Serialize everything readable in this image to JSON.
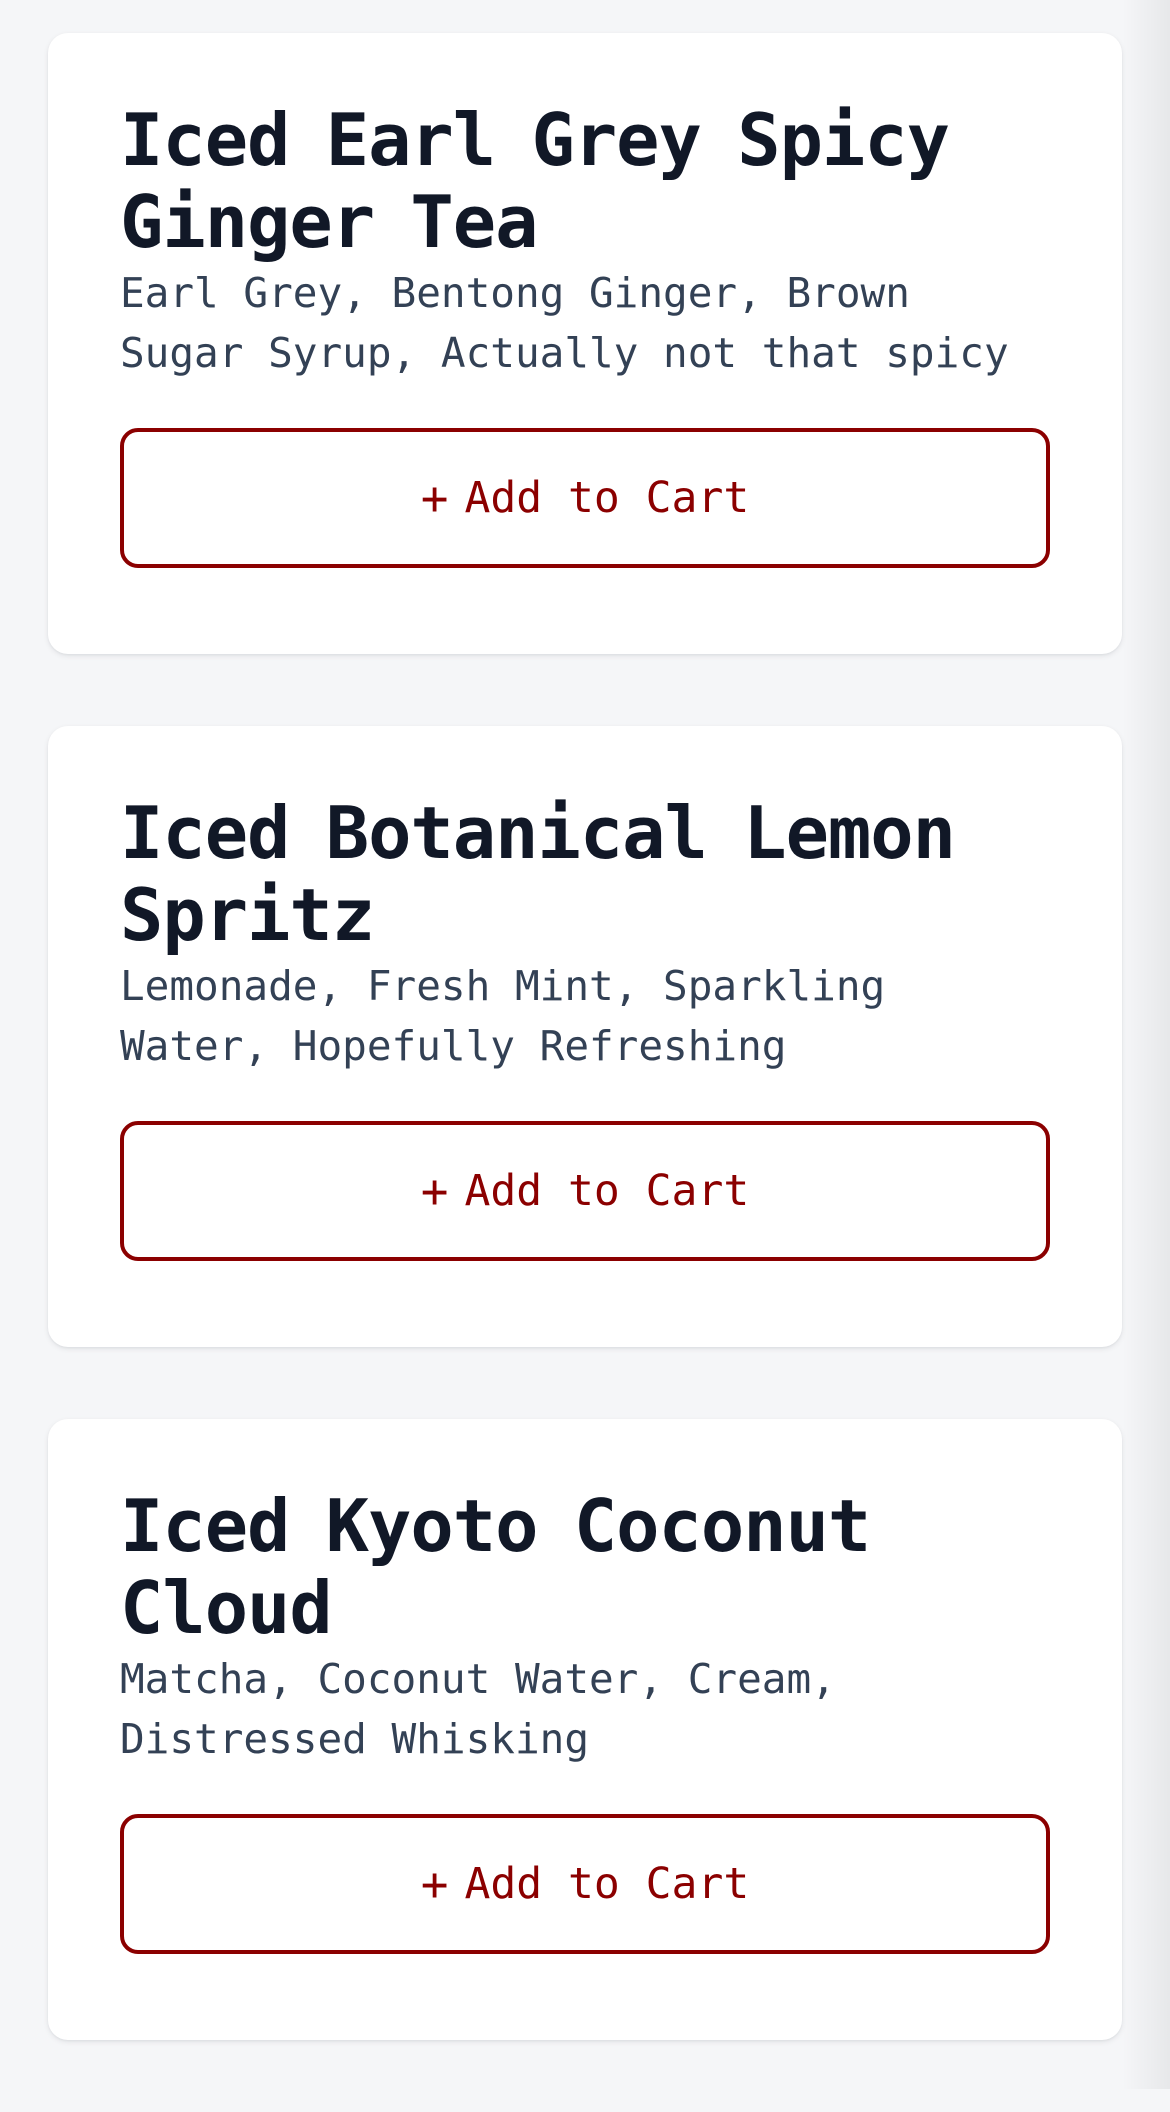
{
  "menu": {
    "items": [
      {
        "title": "Iced Earl Grey Spicy Ginger Tea",
        "description": "Earl Grey, Bentong Ginger, Brown Sugar Syrup, Actually not that spicy",
        "button_label": "Add to Cart",
        "button_icon": "+"
      },
      {
        "title": "Iced Botanical Lemon Spritz",
        "description": "Lemonade, Fresh Mint, Sparkling Water, Hopefully Refreshing",
        "button_label": "Add to Cart",
        "button_icon": "+"
      },
      {
        "title": "Iced Kyoto Coconut Cloud",
        "description": "Matcha, Coconut Water, Cream, Distressed Whisking",
        "button_label": "Add to Cart",
        "button_icon": "+"
      }
    ]
  },
  "colors": {
    "background": "#f5f6f8",
    "card": "#ffffff",
    "title": "#111827",
    "description": "#334155",
    "accent": "#8b0000"
  },
  "icons": {
    "add": "plus-icon"
  }
}
